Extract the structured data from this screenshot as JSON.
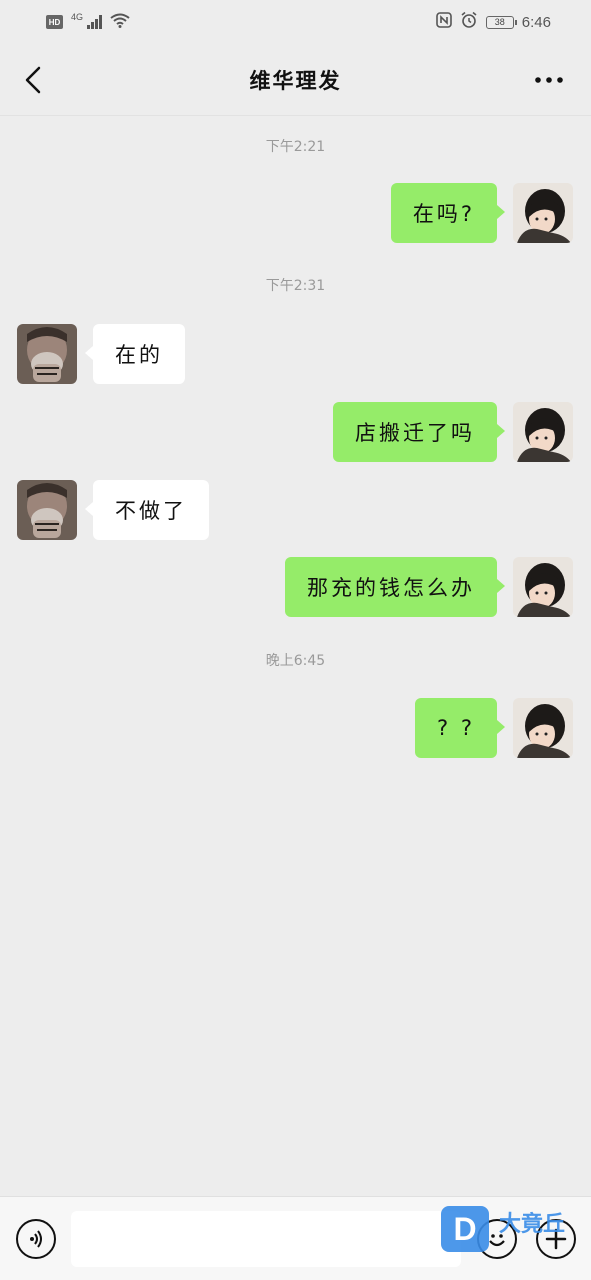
{
  "status_bar": {
    "hd": "HD",
    "network": "4G",
    "battery": "38",
    "time": "6:46"
  },
  "header": {
    "title": "维华理发"
  },
  "timestamps": [
    "下午2:21",
    "下午2:31",
    "晚上6:45"
  ],
  "messages": [
    {
      "direction": "out",
      "text": "在吗?"
    },
    {
      "direction": "in",
      "text": "在的"
    },
    {
      "direction": "out",
      "text": "店搬迁了吗"
    },
    {
      "direction": "in",
      "text": "不做了"
    },
    {
      "direction": "out",
      "text": "那充的钱怎么办"
    },
    {
      "direction": "out",
      "text": "? ?"
    }
  ],
  "input_bar": {
    "placeholder": ""
  },
  "watermark": {
    "logo_letter": "D",
    "text": "大竟丘"
  },
  "colors": {
    "outgoing_bubble": "#95ec69",
    "incoming_bubble": "#ffffff",
    "background": "#ededed",
    "timestamp_text": "#9a9a9a"
  },
  "icons": [
    "back-arrow-icon",
    "more-dots-icon",
    "voice-icon",
    "emoji-icon",
    "plus-icon"
  ]
}
